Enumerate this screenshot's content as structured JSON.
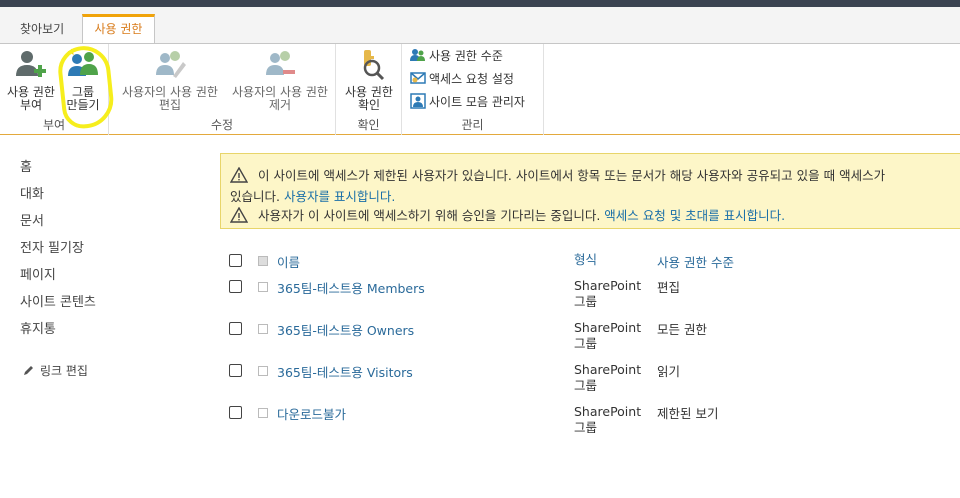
{
  "tabs": {
    "browse": "찾아보기",
    "permissions": "사용 권한"
  },
  "ribbon": {
    "groups": {
      "grant": "부여",
      "modify": "수정",
      "check": "확인",
      "manage": "관리"
    },
    "buttons": {
      "grant_permissions": {
        "line1": "사용 권한",
        "line2": "부여"
      },
      "create_group": {
        "line1": "그룹",
        "line2": "만들기"
      },
      "edit_user_permissions": {
        "line1": "사용자의 사용 권한",
        "line2": "편집"
      },
      "remove_user_permissions": {
        "line1": "사용자의 사용 권한",
        "line2": "제거"
      },
      "check_permissions": {
        "line1": "사용 권한",
        "line2": "확인"
      }
    },
    "manage_items": [
      "사용 권한 수준",
      "액세스 요청 설정",
      "사이트 모음 관리자"
    ]
  },
  "leftnav": {
    "items": [
      "홈",
      "대화",
      "문서",
      "전자 필기장",
      "페이지",
      "사이트 콘텐츠",
      "휴지통"
    ],
    "edit_links": "링크 편집"
  },
  "notice": {
    "line1": "이 사이트에 액세스가 제한된 사용자가 있습니다. 사이트에서 항목 또는 문서가 해당 사용자와 공유되고 있을 때 액세스가",
    "line2_prefix": "있습니다. ",
    "line2_link": "사용자를 표시합니다.",
    "line3_text": "사용자가 이 사이트에 액세스하기 위해 승인을 기다리는 중입니다. ",
    "line3_link": "액세스 요청 및 초대를 표시합니다."
  },
  "table": {
    "headers": {
      "name": "이름",
      "type": "형식",
      "permission": "사용 권한 수준"
    },
    "rows": [
      {
        "name": "365팀-테스트용 Members",
        "type1": "SharePoint",
        "type2": "그룹",
        "permission": "편집"
      },
      {
        "name": "365팀-테스트용 Owners",
        "type1": "SharePoint",
        "type2": "그룹",
        "permission": "모든 권한"
      },
      {
        "name": "365팀-테스트용 Visitors",
        "type1": "SharePoint",
        "type2": "그룹",
        "permission": "읽기"
      },
      {
        "name": "다운로드불가",
        "type1": "SharePoint",
        "type2": "그룹",
        "permission": "제한된 보기"
      }
    ]
  },
  "colors": {
    "accent": "#f0a30a",
    "link": "#2a6a9a",
    "notice_bg": "#fdf6c8",
    "highlight": "#f6ee1d"
  }
}
